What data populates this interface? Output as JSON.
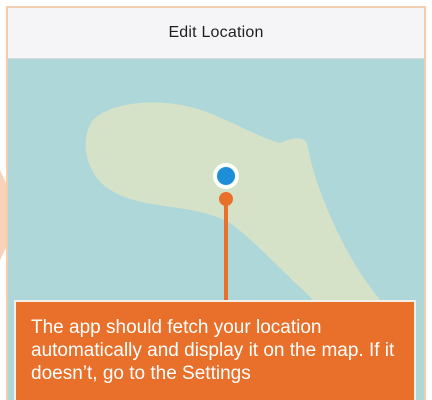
{
  "header": {
    "title": "Edit Location"
  },
  "map": {
    "location_marker": {
      "icon": "location-dot-icon",
      "color": "#1c8fd8"
    },
    "water_color": "#add7d9",
    "land_color": "#d5e2c8"
  },
  "callout": {
    "text": "The app should fetch your location automatically and display it on the map. If it doesn’t, go to the Settings",
    "background_color": "#e8702a",
    "pointer_color": "#e8702a"
  }
}
